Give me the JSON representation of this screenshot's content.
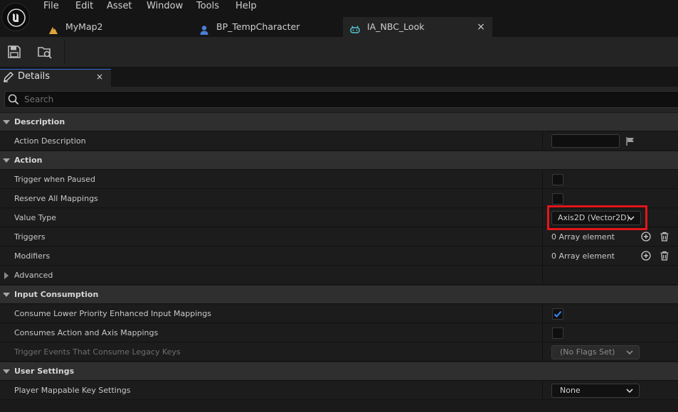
{
  "menu": [
    "File",
    "Edit",
    "Asset",
    "Window",
    "Tools",
    "Help"
  ],
  "tabs": [
    {
      "label": "MyMap2",
      "icon": "level-icon"
    },
    {
      "label": "BP_TempCharacter",
      "icon": "blueprint-icon"
    },
    {
      "label": "IA_NBC_Look",
      "icon": "input-action-icon",
      "active": true
    }
  ],
  "close_glyph": "×",
  "details": {
    "title": "Details"
  },
  "search": {
    "placeholder": "Search",
    "value": ""
  },
  "sections": [
    {
      "name": "Description",
      "rows": [
        {
          "label": "Action Description",
          "widget": "textbox",
          "value": ""
        }
      ]
    },
    {
      "name": "Action",
      "rows": [
        {
          "label": "Trigger when Paused",
          "widget": "checkbox",
          "checked": false
        },
        {
          "label": "Reserve All Mappings",
          "widget": "checkbox",
          "checked": false
        },
        {
          "label": "Value Type",
          "widget": "combo",
          "value": "Axis2D (Vector2D)"
        },
        {
          "label": "Triggers",
          "widget": "array",
          "value": "0 Array element"
        },
        {
          "label": "Modifiers",
          "widget": "array",
          "value": "0 Array element"
        },
        {
          "label": "Advanced",
          "widget": "collapsed"
        }
      ]
    },
    {
      "name": "Input Consumption",
      "rows": [
        {
          "label": "Consume Lower Priority Enhanced Input Mappings",
          "widget": "checkbox",
          "checked": true
        },
        {
          "label": "Consumes Action and Axis Mappings",
          "widget": "checkbox",
          "checked": false
        },
        {
          "label": "Trigger Events That Consume Legacy Keys",
          "widget": "combo-disabled",
          "value": "(No Flags Set)"
        }
      ]
    },
    {
      "name": "User Settings",
      "rows": [
        {
          "label": "Player Mappable Key Settings",
          "widget": "combo",
          "value": "None"
        }
      ]
    }
  ],
  "colors": {
    "accent": "#2e6bd6",
    "highlight": "#e3161b",
    "checkbox_check": "#3a8ef0"
  }
}
